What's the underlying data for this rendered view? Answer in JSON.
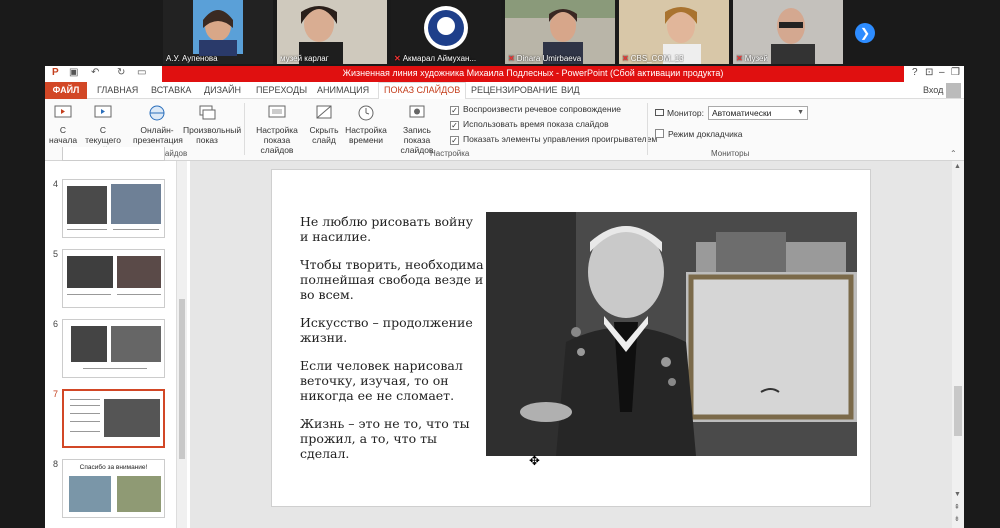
{
  "participants": [
    {
      "name": "А.У. Аупенова",
      "muted": false
    },
    {
      "name": "музей карлаг",
      "muted": false
    },
    {
      "name": "Акмарал Аймухан...",
      "muted": true
    },
    {
      "name": "Dinara Umirbaeva",
      "muted": true
    },
    {
      "name": "CBS_COM_13",
      "muted": true
    },
    {
      "name": "Музей",
      "muted": true
    }
  ],
  "window": {
    "title": "Жизненная линия художника Михаила Подлесных  -  PowerPoint (Сбой активации продукта)",
    "help": "?",
    "login": "Вход"
  },
  "tabs": [
    {
      "label": "ФАЙЛ",
      "kind": "file"
    },
    {
      "label": "ГЛАВНАЯ"
    },
    {
      "label": "ВСТАВКА"
    },
    {
      "label": "ДИЗАЙН"
    },
    {
      "label": "ПЕРЕХОДЫ"
    },
    {
      "label": "АНИМАЦИЯ"
    },
    {
      "label": "ПОКАЗ СЛАЙДОВ",
      "active": true
    },
    {
      "label": "РЕЦЕНЗИРОВАНИЕ"
    },
    {
      "label": "ВИД"
    }
  ],
  "ribbon": {
    "start_group": {
      "label": "Начать показ слайдов",
      "buttons": [
        "С начала",
        "С текущего слайда",
        "Онлайн-презентация",
        "Произвольный показ"
      ]
    },
    "setup_group": {
      "label": "Настройка",
      "buttons": [
        "Настройка показа слайдов",
        "Скрыть слайд",
        "Настройка времени",
        "Запись показа слайдов"
      ],
      "checks": [
        {
          "label": "Воспроизвести речевое сопровождение",
          "checked": true
        },
        {
          "label": "Использовать время показа слайдов",
          "checked": true
        },
        {
          "label": "Показать элементы управления проигрывателем",
          "checked": true
        }
      ]
    },
    "monitors_group": {
      "label": "Мониторы",
      "monitor_label": "Монитор:",
      "monitor_value": "Автоматически",
      "presenter_view": "Режим докладчика"
    }
  },
  "thumbnails": [
    {
      "number": "4"
    },
    {
      "number": "5"
    },
    {
      "number": "6"
    },
    {
      "number": "7",
      "selected": true
    },
    {
      "number": "8",
      "title": "Спасибо за внимание!"
    }
  ],
  "slide": {
    "quotes": [
      "Не люблю рисовать войну и насилие.",
      "Чтобы творить, необходима полнейшая свобода везде и во всем.",
      "Искусство – продолжение жизни.",
      "Если человек нарисовал веточку, изучая, то он никогда ее не сломает.",
      "Жизнь – это не то, что ты прожил, а то, что ты сделал."
    ]
  },
  "colors": {
    "accent": "#d24726",
    "title_bar": "#e01010",
    "zoom_blue": "#2d8cff"
  }
}
